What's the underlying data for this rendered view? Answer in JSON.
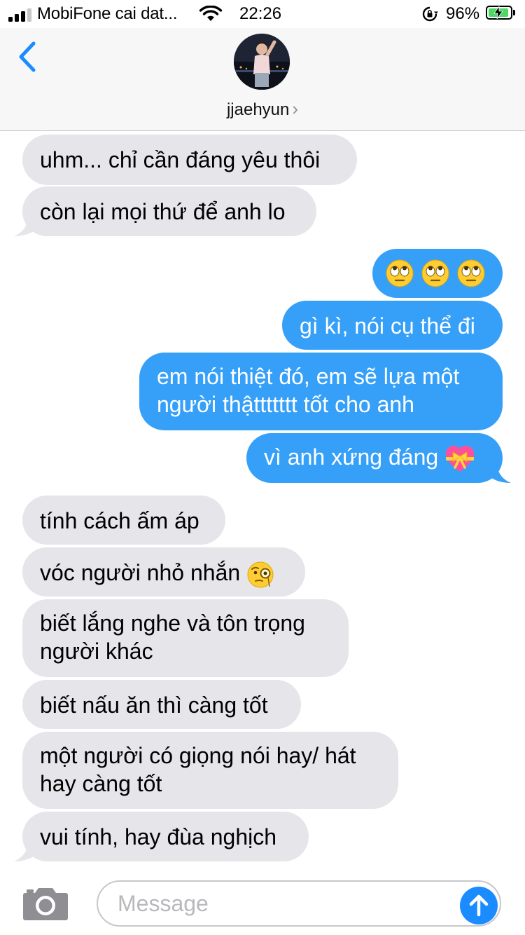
{
  "status_bar": {
    "carrier": "MobiFone cai dat...",
    "time": "22:26",
    "battery_percent": "96%",
    "battery_level": 0.96,
    "signal_bars": 3,
    "charging": true
  },
  "header": {
    "contact_name": "jjaehyun",
    "chevron": "›",
    "back_icon": "chevron-left-icon",
    "accent_color": "#1a8cff"
  },
  "messages": [
    {
      "direction": "incoming",
      "text": "uhm... chỉ cần đáng yêu thôi"
    },
    {
      "direction": "incoming",
      "text": "còn lại mọi thứ để anh lo"
    },
    {
      "direction": "outgoing",
      "text": "",
      "emoji": [
        "face-with-rolling-eyes",
        "face-with-rolling-eyes",
        "face-with-rolling-eyes"
      ]
    },
    {
      "direction": "outgoing",
      "text": "gì kì, nói cụ thể đi"
    },
    {
      "direction": "outgoing",
      "lines": [
        "em nói thiệt đó, em sẽ lựa một",
        "người thậttttttt tốt cho anh"
      ]
    },
    {
      "direction": "outgoing",
      "text": "vì anh xứng đáng",
      "emoji": [
        "heart-with-ribbon"
      ]
    },
    {
      "direction": "incoming",
      "text": "tính cách ấm áp"
    },
    {
      "direction": "incoming",
      "text": "vóc người nhỏ nhắn",
      "emoji": [
        "face-with-monocle"
      ]
    },
    {
      "direction": "incoming",
      "lines": [
        "biết lắng nghe và tôn trọng",
        "người khác"
      ]
    },
    {
      "direction": "incoming",
      "text": "biết nấu ăn thì càng tốt"
    },
    {
      "direction": "incoming",
      "lines": [
        "một người có giọng nói hay/ hát",
        "hay càng tốt"
      ]
    },
    {
      "direction": "incoming",
      "text": "vui tính, hay đùa nghịch"
    }
  ],
  "compose": {
    "placeholder": "Message",
    "value": "",
    "camera_icon": "camera-icon",
    "send_icon": "arrow-up-icon"
  },
  "colors": {
    "incoming_bubble": "#e5e5ea",
    "outgoing_bubble": "#1a8cff",
    "header_bg": "#f7f7f7"
  }
}
